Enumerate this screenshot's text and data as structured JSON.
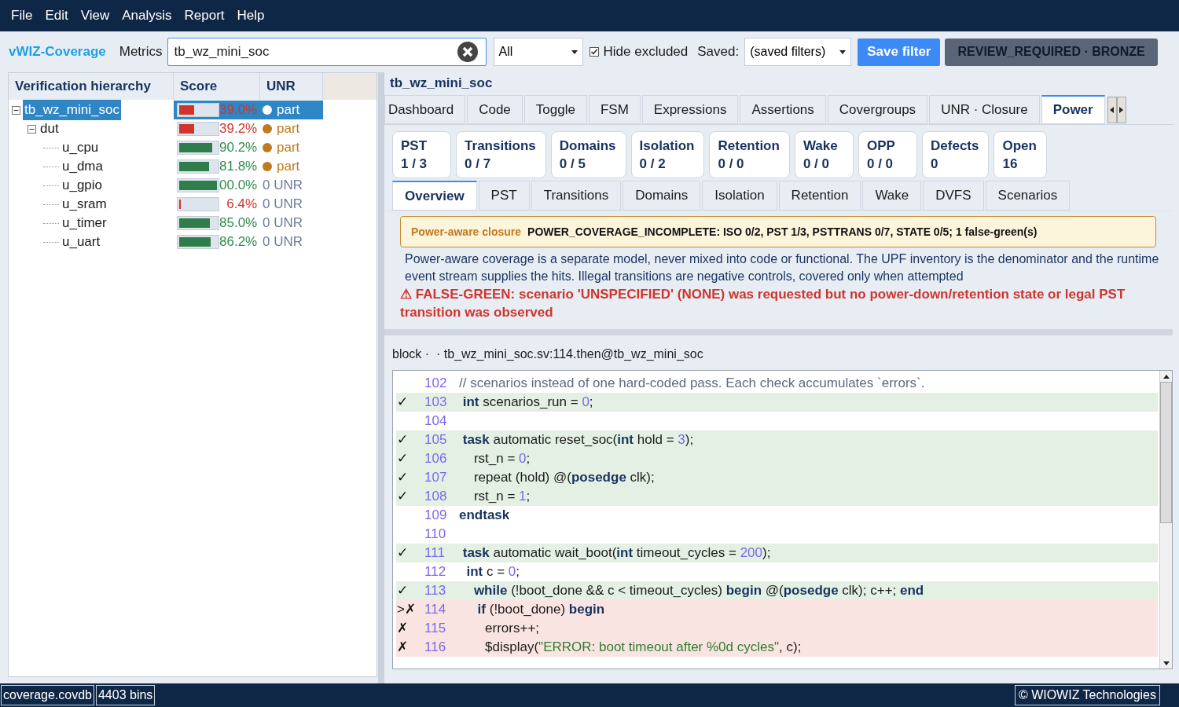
{
  "menu": [
    "File",
    "Edit",
    "View",
    "Analysis",
    "Report",
    "Help"
  ],
  "toolbar": {
    "app_name": "vWIZ-Coverage",
    "metrics_label": "Metrics",
    "search_value": "tb_wz_mini_soc",
    "filter_select": "All",
    "hide_excluded": {
      "label": "Hide excluded",
      "checked": true
    },
    "saved_label": "Saved:",
    "saved_select": "(saved filters)",
    "save_button": "Save filter",
    "verdict": "REVIEW_REQUIRED · BRONZE"
  },
  "hierarchy": {
    "columns": [
      "Verification hierarchy",
      "Score",
      "UNR"
    ],
    "nodes": [
      {
        "name": "tb_wz_mini_soc",
        "selected": true,
        "expanded": true,
        "score": "39.0%",
        "level": 0.39,
        "unr": "part",
        "color": "#ffffff",
        "children": [
          {
            "name": "dut",
            "selected": false,
            "expanded": true,
            "score": "39.2%",
            "level": 0.39,
            "unr": "part",
            "color": "#c07a1e",
            "children": [
              {
                "name": "u_cpu",
                "selected": false,
                "score": "90.2%",
                "level": 0.88,
                "unr": "part",
                "color": "#c07a1e"
              },
              {
                "name": "u_dma",
                "selected": false,
                "score": "81.8%",
                "level": 0.8,
                "unr": "part",
                "color": "#c07a1e"
              },
              {
                "name": "u_gpio",
                "selected": false,
                "score": "00.0%",
                "level": 1.0,
                "unr": "0 UNR"
              },
              {
                "name": "u_sram",
                "selected": false,
                "score": "6.4%",
                "level": 0.04,
                "unr": "0 UNR"
              },
              {
                "name": "u_timer",
                "selected": false,
                "score": "85.0%",
                "level": 0.82,
                "unr": "0 UNR"
              },
              {
                "name": "u_uart",
                "selected": false,
                "score": "86.2%",
                "level": 0.84,
                "unr": "0 UNR"
              }
            ]
          }
        ]
      }
    ]
  },
  "detail": {
    "title": "tb_wz_mini_soc",
    "tabs": [
      {
        "label": "Dashboard",
        "selected": false
      },
      {
        "label": "Code",
        "selected": false
      },
      {
        "label": "Toggle",
        "selected": false
      },
      {
        "label": "FSM",
        "selected": false
      },
      {
        "label": "Expressions",
        "selected": false
      },
      {
        "label": "Assertions",
        "selected": false
      },
      {
        "label": "Covergroups",
        "selected": false
      },
      {
        "label": "UNR · Closure",
        "selected": false
      },
      {
        "label": "Power",
        "selected": true
      }
    ],
    "stats": [
      {
        "label": "PST",
        "value": "1 / 3"
      },
      {
        "label": "Transitions",
        "value": "0 / 7"
      },
      {
        "label": "Domains",
        "value": "0 / 5"
      },
      {
        "label": "Isolation",
        "value": "0 / 2"
      },
      {
        "label": "Retention",
        "value": "0 / 0"
      },
      {
        "label": "Wake",
        "value": "0 / 0"
      },
      {
        "label": "OPP",
        "value": "0 / 0"
      },
      {
        "label": "Defects",
        "value": "0"
      },
      {
        "label": "Open",
        "value": "16"
      }
    ],
    "subtabs": [
      {
        "label": "Overview",
        "selected": true
      },
      {
        "label": "PST",
        "selected": false
      },
      {
        "label": "Transitions",
        "selected": false
      },
      {
        "label": "Domains",
        "selected": false
      },
      {
        "label": "Isolation",
        "selected": false
      },
      {
        "label": "Retention",
        "selected": false
      },
      {
        "label": "Wake",
        "selected": false
      },
      {
        "label": "DVFS",
        "selected": false
      },
      {
        "label": "Scenarios",
        "selected": false
      }
    ],
    "banner": {
      "label": "Power-aware closure",
      "message": "POWER_COVERAGE_INCOMPLETE: ISO 0/2, PST 1/3, PSTTRANS 0/7, STATE 0/5; 1 false-green(s)"
    },
    "description": "Power-aware coverage is a separate model, never mixed into code or functional. The UPF inventory is the denominator and the runtime event stream supplies the hits. Illegal transitions are negative controls, covered only when attempted",
    "warning": "⚠ FALSE-GREEN: scenario 'UNSPECIFIED' (NONE) was requested but no power-down/retention state or legal PST transition was observed",
    "source_path": "block ·  · tb_wz_mini_soc.sv:114.then@tb_wz_mini_soc",
    "code": [
      {
        "kind": "plain",
        "num": "102",
        "segments": [
          {
            "kind": "comment",
            "text": "// scenarios instead of one hard-coded pass. Each check accumulates `errors`."
          }
        ]
      },
      {
        "kind": "hit",
        "mark": "✓",
        "num": "103",
        "segments": [
          {
            "kind": "kw",
            "text": " int"
          },
          {
            "kind": "plain",
            "text": " scenarios_run = "
          },
          {
            "kind": "num",
            "text": "0"
          },
          {
            "kind": "plain",
            "text": ";"
          }
        ]
      },
      {
        "kind": "plain",
        "num": "104"
      },
      {
        "kind": "hit",
        "mark": "✓",
        "num": "105",
        "segments": [
          {
            "kind": "kw",
            "text": " task"
          },
          {
            "kind": "plain",
            "text": " automatic reset_soc("
          },
          {
            "kind": "kw",
            "text": "int"
          },
          {
            "kind": "plain",
            "text": " hold = "
          },
          {
            "kind": "num",
            "text": "3"
          },
          {
            "kind": "plain",
            "text": ");"
          }
        ]
      },
      {
        "kind": "hit",
        "mark": "✓",
        "num": "106",
        "segments": [
          {
            "kind": "plain",
            "text": "    rst_n = "
          },
          {
            "kind": "num",
            "text": "0"
          },
          {
            "kind": "plain",
            "text": ";"
          }
        ]
      },
      {
        "kind": "hit",
        "mark": "✓",
        "num": "107",
        "segments": [
          {
            "kind": "plain",
            "text": "    repeat (hold) @("
          },
          {
            "kind": "kw",
            "text": "posedge"
          },
          {
            "kind": "plain",
            "text": " clk);"
          }
        ]
      },
      {
        "kind": "hit",
        "mark": "✓",
        "num": "108",
        "segments": [
          {
            "kind": "plain",
            "text": "    rst_n = "
          },
          {
            "kind": "num",
            "text": "1"
          },
          {
            "kind": "plain",
            "text": ";"
          }
        ]
      },
      {
        "kind": "plain",
        "num": "109",
        "segments": [
          {
            "kind": "kw",
            "text": "endtask"
          }
        ]
      },
      {
        "kind": "plain",
        "num": "110"
      },
      {
        "kind": "hit",
        "mark": "✓",
        "num": "111",
        "segments": [
          {
            "kind": "kw",
            "text": " task"
          },
          {
            "kind": "plain",
            "text": " automatic wait_boot("
          },
          {
            "kind": "kw",
            "text": "int"
          },
          {
            "kind": "plain",
            "text": " timeout_cycles = "
          },
          {
            "kind": "num",
            "text": "200"
          },
          {
            "kind": "plain",
            "text": ");"
          }
        ]
      },
      {
        "kind": "plain",
        "num": "112",
        "segments": [
          {
            "kind": "kw",
            "text": "  int"
          },
          {
            "kind": "plain",
            "text": " c = "
          },
          {
            "kind": "num",
            "text": "0"
          },
          {
            "kind": "plain",
            "text": ";"
          }
        ]
      },
      {
        "kind": "hit",
        "mark": "✓",
        "num": "113",
        "segments": [
          {
            "kind": "kw",
            "text": "    while"
          },
          {
            "kind": "plain",
            "text": " (!boot_done && c < timeout_cycles) "
          },
          {
            "kind": "kw",
            "text": "begin"
          },
          {
            "kind": "plain",
            "text": " @("
          },
          {
            "kind": "kw",
            "text": "posedge"
          },
          {
            "kind": "plain",
            "text": " clk); c++; "
          },
          {
            "kind": "kw",
            "text": "end"
          }
        ]
      },
      {
        "kind": "miss",
        "mark": ">✗",
        "num": "114",
        "segments": [
          {
            "kind": "kw",
            "text": "     if"
          },
          {
            "kind": "plain",
            "text": " (!boot_done) "
          },
          {
            "kind": "kw",
            "text": "begin"
          }
        ]
      },
      {
        "kind": "miss",
        "mark": "✗",
        "num": "115",
        "segments": [
          {
            "kind": "plain",
            "text": "       errors++;"
          }
        ]
      },
      {
        "kind": "miss",
        "mark": "✗",
        "num": "116",
        "segments": [
          {
            "kind": "plain",
            "text": "       $display("
          },
          {
            "kind": "str",
            "text": "\"ERROR: boot timeout after %0d cycles\""
          },
          {
            "kind": "plain",
            "text": ", c);"
          }
        ]
      }
    ]
  },
  "status_bar": {
    "file": "coverage.covdb",
    "bins": "4403 bins",
    "copyright": "© WIOWIZ Technologies"
  }
}
